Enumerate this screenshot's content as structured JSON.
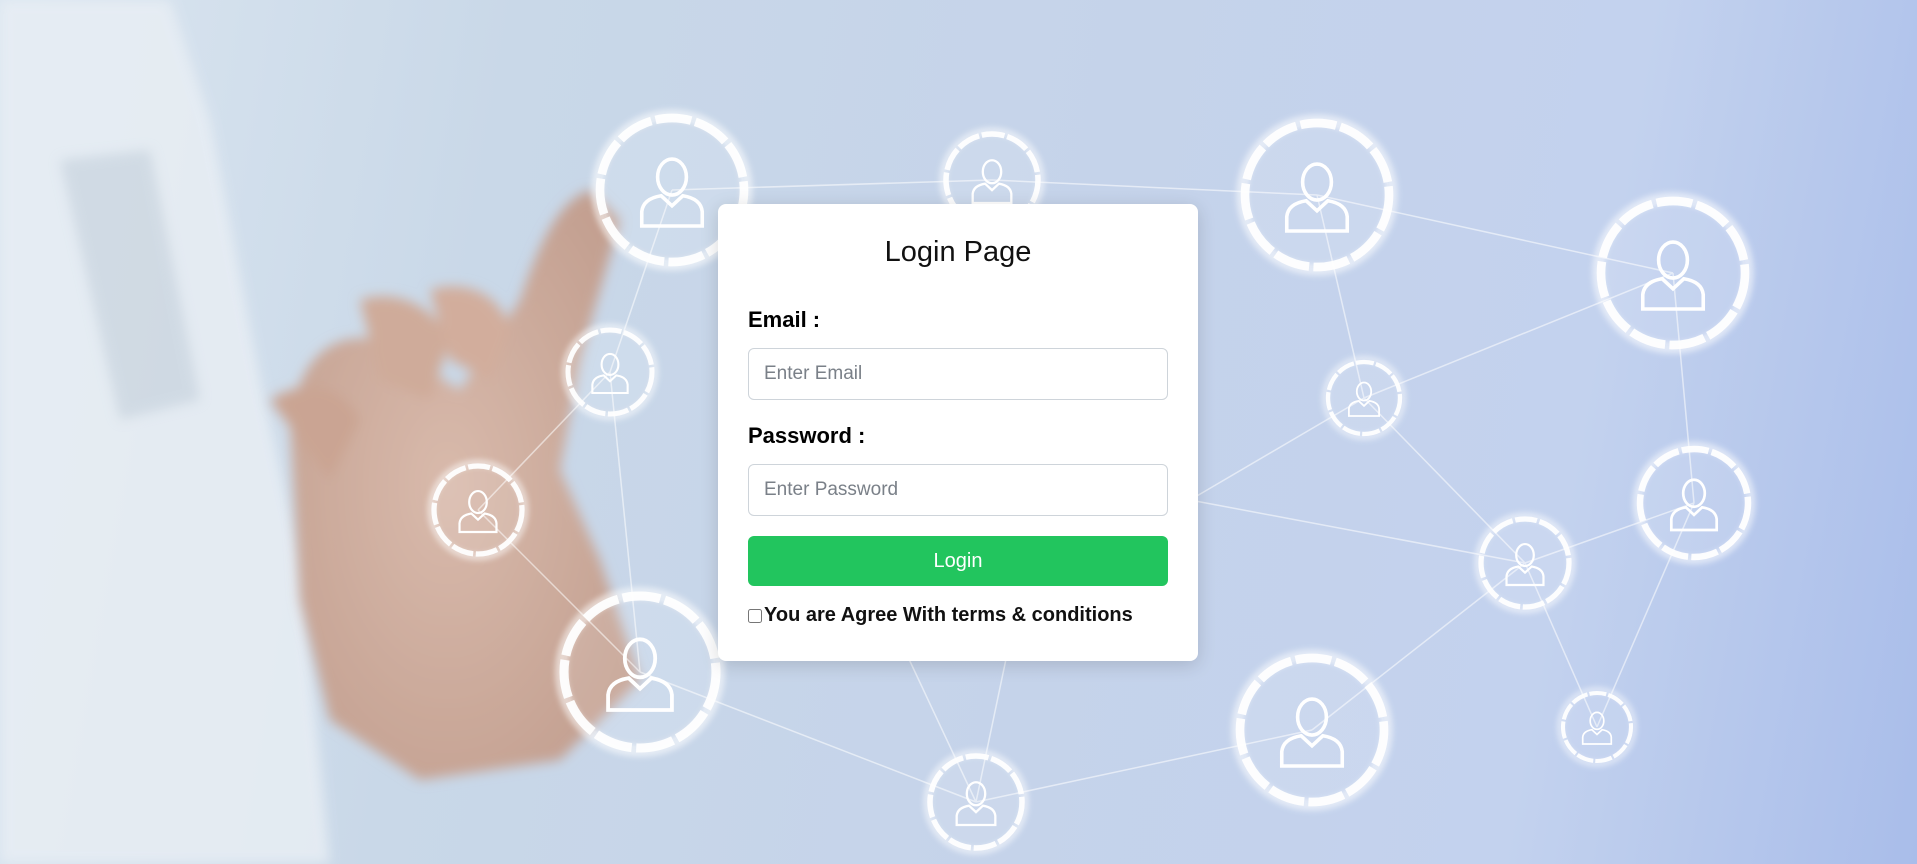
{
  "login_form": {
    "title": "Login Page",
    "email_label": "Email :",
    "email_placeholder": "Enter Email",
    "email_value": "",
    "password_label": "Password :",
    "password_placeholder": "Enter Password",
    "password_value": "",
    "login_button_label": "Login",
    "terms_label": "You are Agree With terms & conditions",
    "terms_checked": false
  },
  "colors": {
    "login_button": "#22c55e",
    "card_background": "#ffffff",
    "background_tint": "#c5d3ea"
  },
  "background": {
    "icons": [
      "user-icon"
    ]
  }
}
